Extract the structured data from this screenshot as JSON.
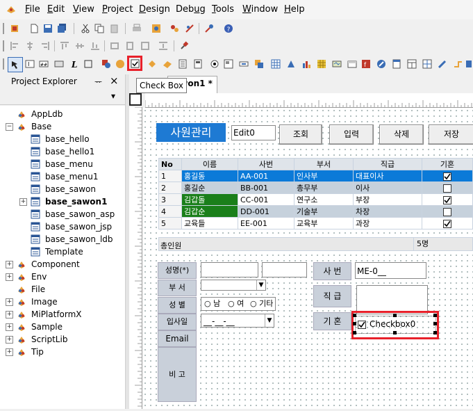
{
  "menu": [
    {
      "label": "File",
      "key": "F",
      "rest": "ile"
    },
    {
      "label": "Edit",
      "key": "E",
      "rest": "dit"
    },
    {
      "label": "View",
      "key": "V",
      "rest": "iew"
    },
    {
      "label": "Project",
      "key": "P",
      "rest": "roject"
    },
    {
      "label": "Design",
      "key": "D",
      "rest": "esign"
    },
    {
      "label": "Debug",
      "pre": "Deb",
      "key": "u",
      "rest": "g"
    },
    {
      "label": "Tools",
      "key": "T",
      "rest": "ools"
    },
    {
      "label": "Window",
      "key": "W",
      "rest": "indow"
    },
    {
      "label": "Help",
      "key": "H",
      "rest": "elp"
    }
  ],
  "tooltip": "Check Box",
  "project_explorer": {
    "title": "Project Explorer",
    "pin": "ᅲ",
    "close": "×",
    "dropdown": "▾"
  },
  "tree": [
    {
      "label": "AppLdb",
      "level": 0,
      "expander": ""
    },
    {
      "label": "Base",
      "level": 0,
      "expander": "−"
    },
    {
      "label": "base_hello",
      "level": 1,
      "expander": ""
    },
    {
      "label": "base_hello1",
      "level": 1,
      "expander": ""
    },
    {
      "label": "base_menu",
      "level": 1,
      "expander": ""
    },
    {
      "label": "base_menu1",
      "level": 1,
      "expander": ""
    },
    {
      "label": "base_sawon",
      "level": 1,
      "expander": ""
    },
    {
      "label": "base_sawon1",
      "level": 1,
      "expander": "+",
      "bold": true
    },
    {
      "label": "base_sawon_asp",
      "level": 1,
      "expander": ""
    },
    {
      "label": "base_sawon_jsp",
      "level": 1,
      "expander": ""
    },
    {
      "label": "base_sawon_ldb",
      "level": 1,
      "expander": ""
    },
    {
      "label": "Template",
      "level": 1,
      "expander": ""
    },
    {
      "label": "Component",
      "level": 0,
      "expander": "+"
    },
    {
      "label": "Env",
      "level": 0,
      "expander": "+"
    },
    {
      "label": "File",
      "level": 0,
      "expander": ""
    },
    {
      "label": "Image",
      "level": 0,
      "expander": "+"
    },
    {
      "label": "MiPlatformX",
      "level": 0,
      "expander": "+"
    },
    {
      "label": "Sample",
      "level": 0,
      "expander": "+"
    },
    {
      "label": "ScriptLib",
      "level": 0,
      "expander": "+"
    },
    {
      "label": "Tip",
      "level": 0,
      "expander": "+"
    }
  ],
  "doc_tab": "sawon1 *",
  "form": {
    "title": "사원관리",
    "edit0": "Edit0",
    "buttons": [
      "조회",
      "입력",
      "삭제",
      "저장"
    ],
    "grid": {
      "headers": [
        "No",
        "이름",
        "사번",
        "부서",
        "직급",
        "기혼"
      ],
      "rows": [
        {
          "no": "1",
          "name": "홍길동",
          "id": "AA-001",
          "dept": "인사부",
          "rank": "대표이사",
          "married": true
        },
        {
          "no": "2",
          "name": "홍길순",
          "id": "BB-001",
          "dept": "총무부",
          "rank": "이사",
          "married": false
        },
        {
          "no": "3",
          "name": "김갑돌",
          "id": "CC-001",
          "dept": "연구소",
          "rank": "부장",
          "married": true
        },
        {
          "no": "4",
          "name": "김갑순",
          "id": "DD-001",
          "dept": "기술부",
          "rank": "차장",
          "married": false
        },
        {
          "no": "5",
          "name": "교육들",
          "id": "EE-001",
          "dept": "교육부",
          "rank": "과장",
          "married": true
        }
      ],
      "footer_label": "총인원",
      "footer_value": "5명"
    },
    "labels": {
      "name": "성명(*)",
      "dept": "부 서",
      "gender": "성 별",
      "join": "입사일",
      "email": "Email",
      "note": "비 고",
      "empno": "사 번",
      "rank": "직 급",
      "married": "기 혼"
    },
    "empno_value": "ME-0__",
    "date_value": "__-__-__",
    "gender_options": [
      "남",
      "여",
      "기타"
    ],
    "checkbox_label": "Checkbox0"
  },
  "colors": {
    "title_bg": "#1e7ad3",
    "selected_row": "#0b7ad8",
    "green_cell": "#1a7f1a",
    "alt_row": "#c6d1dc",
    "highlight_red": "#e8202a"
  }
}
